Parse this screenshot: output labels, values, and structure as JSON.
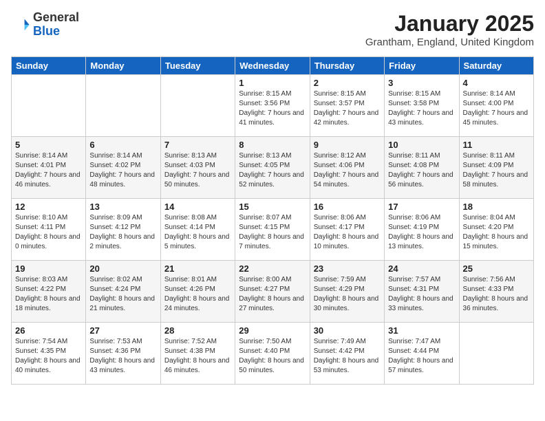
{
  "header": {
    "logo_general": "General",
    "logo_blue": "Blue",
    "month": "January 2025",
    "location": "Grantham, England, United Kingdom"
  },
  "days_of_week": [
    "Sunday",
    "Monday",
    "Tuesday",
    "Wednesday",
    "Thursday",
    "Friday",
    "Saturday"
  ],
  "weeks": [
    [
      {
        "day": "",
        "info": ""
      },
      {
        "day": "",
        "info": ""
      },
      {
        "day": "",
        "info": ""
      },
      {
        "day": "1",
        "info": "Sunrise: 8:15 AM\nSunset: 3:56 PM\nDaylight: 7 hours and 41 minutes."
      },
      {
        "day": "2",
        "info": "Sunrise: 8:15 AM\nSunset: 3:57 PM\nDaylight: 7 hours and 42 minutes."
      },
      {
        "day": "3",
        "info": "Sunrise: 8:15 AM\nSunset: 3:58 PM\nDaylight: 7 hours and 43 minutes."
      },
      {
        "day": "4",
        "info": "Sunrise: 8:14 AM\nSunset: 4:00 PM\nDaylight: 7 hours and 45 minutes."
      }
    ],
    [
      {
        "day": "5",
        "info": "Sunrise: 8:14 AM\nSunset: 4:01 PM\nDaylight: 7 hours and 46 minutes."
      },
      {
        "day": "6",
        "info": "Sunrise: 8:14 AM\nSunset: 4:02 PM\nDaylight: 7 hours and 48 minutes."
      },
      {
        "day": "7",
        "info": "Sunrise: 8:13 AM\nSunset: 4:03 PM\nDaylight: 7 hours and 50 minutes."
      },
      {
        "day": "8",
        "info": "Sunrise: 8:13 AM\nSunset: 4:05 PM\nDaylight: 7 hours and 52 minutes."
      },
      {
        "day": "9",
        "info": "Sunrise: 8:12 AM\nSunset: 4:06 PM\nDaylight: 7 hours and 54 minutes."
      },
      {
        "day": "10",
        "info": "Sunrise: 8:11 AM\nSunset: 4:08 PM\nDaylight: 7 hours and 56 minutes."
      },
      {
        "day": "11",
        "info": "Sunrise: 8:11 AM\nSunset: 4:09 PM\nDaylight: 7 hours and 58 minutes."
      }
    ],
    [
      {
        "day": "12",
        "info": "Sunrise: 8:10 AM\nSunset: 4:11 PM\nDaylight: 8 hours and 0 minutes."
      },
      {
        "day": "13",
        "info": "Sunrise: 8:09 AM\nSunset: 4:12 PM\nDaylight: 8 hours and 2 minutes."
      },
      {
        "day": "14",
        "info": "Sunrise: 8:08 AM\nSunset: 4:14 PM\nDaylight: 8 hours and 5 minutes."
      },
      {
        "day": "15",
        "info": "Sunrise: 8:07 AM\nSunset: 4:15 PM\nDaylight: 8 hours and 7 minutes."
      },
      {
        "day": "16",
        "info": "Sunrise: 8:06 AM\nSunset: 4:17 PM\nDaylight: 8 hours and 10 minutes."
      },
      {
        "day": "17",
        "info": "Sunrise: 8:06 AM\nSunset: 4:19 PM\nDaylight: 8 hours and 13 minutes."
      },
      {
        "day": "18",
        "info": "Sunrise: 8:04 AM\nSunset: 4:20 PM\nDaylight: 8 hours and 15 minutes."
      }
    ],
    [
      {
        "day": "19",
        "info": "Sunrise: 8:03 AM\nSunset: 4:22 PM\nDaylight: 8 hours and 18 minutes."
      },
      {
        "day": "20",
        "info": "Sunrise: 8:02 AM\nSunset: 4:24 PM\nDaylight: 8 hours and 21 minutes."
      },
      {
        "day": "21",
        "info": "Sunrise: 8:01 AM\nSunset: 4:26 PM\nDaylight: 8 hours and 24 minutes."
      },
      {
        "day": "22",
        "info": "Sunrise: 8:00 AM\nSunset: 4:27 PM\nDaylight: 8 hours and 27 minutes."
      },
      {
        "day": "23",
        "info": "Sunrise: 7:59 AM\nSunset: 4:29 PM\nDaylight: 8 hours and 30 minutes."
      },
      {
        "day": "24",
        "info": "Sunrise: 7:57 AM\nSunset: 4:31 PM\nDaylight: 8 hours and 33 minutes."
      },
      {
        "day": "25",
        "info": "Sunrise: 7:56 AM\nSunset: 4:33 PM\nDaylight: 8 hours and 36 minutes."
      }
    ],
    [
      {
        "day": "26",
        "info": "Sunrise: 7:54 AM\nSunset: 4:35 PM\nDaylight: 8 hours and 40 minutes."
      },
      {
        "day": "27",
        "info": "Sunrise: 7:53 AM\nSunset: 4:36 PM\nDaylight: 8 hours and 43 minutes."
      },
      {
        "day": "28",
        "info": "Sunrise: 7:52 AM\nSunset: 4:38 PM\nDaylight: 8 hours and 46 minutes."
      },
      {
        "day": "29",
        "info": "Sunrise: 7:50 AM\nSunset: 4:40 PM\nDaylight: 8 hours and 50 minutes."
      },
      {
        "day": "30",
        "info": "Sunrise: 7:49 AM\nSunset: 4:42 PM\nDaylight: 8 hours and 53 minutes."
      },
      {
        "day": "31",
        "info": "Sunrise: 7:47 AM\nSunset: 4:44 PM\nDaylight: 8 hours and 57 minutes."
      },
      {
        "day": "",
        "info": ""
      }
    ]
  ]
}
